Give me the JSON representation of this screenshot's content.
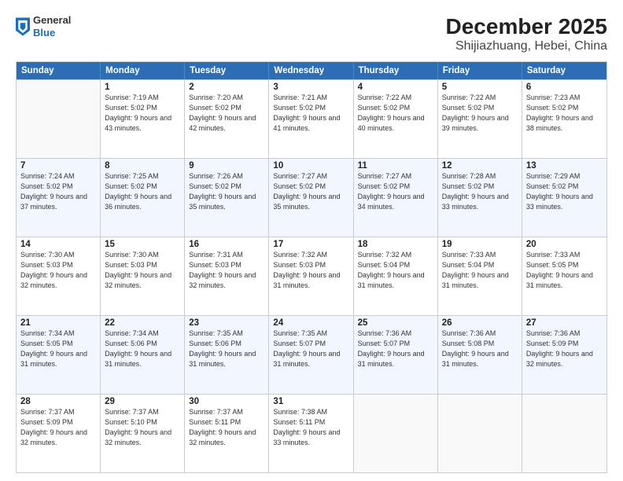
{
  "header": {
    "logo_general": "General",
    "logo_blue": "Blue",
    "title": "December 2025",
    "subtitle": "Shijiazhuang, Hebei, China"
  },
  "calendar": {
    "days_of_week": [
      "Sunday",
      "Monday",
      "Tuesday",
      "Wednesday",
      "Thursday",
      "Friday",
      "Saturday"
    ],
    "weeks": [
      [
        {
          "day": "",
          "sunrise": "",
          "sunset": "",
          "daylight": "",
          "empty": true
        },
        {
          "day": "1",
          "sunrise": "Sunrise: 7:19 AM",
          "sunset": "Sunset: 5:02 PM",
          "daylight": "Daylight: 9 hours and 43 minutes."
        },
        {
          "day": "2",
          "sunrise": "Sunrise: 7:20 AM",
          "sunset": "Sunset: 5:02 PM",
          "daylight": "Daylight: 9 hours and 42 minutes."
        },
        {
          "day": "3",
          "sunrise": "Sunrise: 7:21 AM",
          "sunset": "Sunset: 5:02 PM",
          "daylight": "Daylight: 9 hours and 41 minutes."
        },
        {
          "day": "4",
          "sunrise": "Sunrise: 7:22 AM",
          "sunset": "Sunset: 5:02 PM",
          "daylight": "Daylight: 9 hours and 40 minutes."
        },
        {
          "day": "5",
          "sunrise": "Sunrise: 7:22 AM",
          "sunset": "Sunset: 5:02 PM",
          "daylight": "Daylight: 9 hours and 39 minutes."
        },
        {
          "day": "6",
          "sunrise": "Sunrise: 7:23 AM",
          "sunset": "Sunset: 5:02 PM",
          "daylight": "Daylight: 9 hours and 38 minutes."
        }
      ],
      [
        {
          "day": "7",
          "sunrise": "Sunrise: 7:24 AM",
          "sunset": "Sunset: 5:02 PM",
          "daylight": "Daylight: 9 hours and 37 minutes."
        },
        {
          "day": "8",
          "sunrise": "Sunrise: 7:25 AM",
          "sunset": "Sunset: 5:02 PM",
          "daylight": "Daylight: 9 hours and 36 minutes."
        },
        {
          "day": "9",
          "sunrise": "Sunrise: 7:26 AM",
          "sunset": "Sunset: 5:02 PM",
          "daylight": "Daylight: 9 hours and 35 minutes."
        },
        {
          "day": "10",
          "sunrise": "Sunrise: 7:27 AM",
          "sunset": "Sunset: 5:02 PM",
          "daylight": "Daylight: 9 hours and 35 minutes."
        },
        {
          "day": "11",
          "sunrise": "Sunrise: 7:27 AM",
          "sunset": "Sunset: 5:02 PM",
          "daylight": "Daylight: 9 hours and 34 minutes."
        },
        {
          "day": "12",
          "sunrise": "Sunrise: 7:28 AM",
          "sunset": "Sunset: 5:02 PM",
          "daylight": "Daylight: 9 hours and 33 minutes."
        },
        {
          "day": "13",
          "sunrise": "Sunrise: 7:29 AM",
          "sunset": "Sunset: 5:02 PM",
          "daylight": "Daylight: 9 hours and 33 minutes."
        }
      ],
      [
        {
          "day": "14",
          "sunrise": "Sunrise: 7:30 AM",
          "sunset": "Sunset: 5:03 PM",
          "daylight": "Daylight: 9 hours and 32 minutes."
        },
        {
          "day": "15",
          "sunrise": "Sunrise: 7:30 AM",
          "sunset": "Sunset: 5:03 PM",
          "daylight": "Daylight: 9 hours and 32 minutes."
        },
        {
          "day": "16",
          "sunrise": "Sunrise: 7:31 AM",
          "sunset": "Sunset: 5:03 PM",
          "daylight": "Daylight: 9 hours and 32 minutes."
        },
        {
          "day": "17",
          "sunrise": "Sunrise: 7:32 AM",
          "sunset": "Sunset: 5:03 PM",
          "daylight": "Daylight: 9 hours and 31 minutes."
        },
        {
          "day": "18",
          "sunrise": "Sunrise: 7:32 AM",
          "sunset": "Sunset: 5:04 PM",
          "daylight": "Daylight: 9 hours and 31 minutes."
        },
        {
          "day": "19",
          "sunrise": "Sunrise: 7:33 AM",
          "sunset": "Sunset: 5:04 PM",
          "daylight": "Daylight: 9 hours and 31 minutes."
        },
        {
          "day": "20",
          "sunrise": "Sunrise: 7:33 AM",
          "sunset": "Sunset: 5:05 PM",
          "daylight": "Daylight: 9 hours and 31 minutes."
        }
      ],
      [
        {
          "day": "21",
          "sunrise": "Sunrise: 7:34 AM",
          "sunset": "Sunset: 5:05 PM",
          "daylight": "Daylight: 9 hours and 31 minutes."
        },
        {
          "day": "22",
          "sunrise": "Sunrise: 7:34 AM",
          "sunset": "Sunset: 5:06 PM",
          "daylight": "Daylight: 9 hours and 31 minutes."
        },
        {
          "day": "23",
          "sunrise": "Sunrise: 7:35 AM",
          "sunset": "Sunset: 5:06 PM",
          "daylight": "Daylight: 9 hours and 31 minutes."
        },
        {
          "day": "24",
          "sunrise": "Sunrise: 7:35 AM",
          "sunset": "Sunset: 5:07 PM",
          "daylight": "Daylight: 9 hours and 31 minutes."
        },
        {
          "day": "25",
          "sunrise": "Sunrise: 7:36 AM",
          "sunset": "Sunset: 5:07 PM",
          "daylight": "Daylight: 9 hours and 31 minutes."
        },
        {
          "day": "26",
          "sunrise": "Sunrise: 7:36 AM",
          "sunset": "Sunset: 5:08 PM",
          "daylight": "Daylight: 9 hours and 31 minutes."
        },
        {
          "day": "27",
          "sunrise": "Sunrise: 7:36 AM",
          "sunset": "Sunset: 5:09 PM",
          "daylight": "Daylight: 9 hours and 32 minutes."
        }
      ],
      [
        {
          "day": "28",
          "sunrise": "Sunrise: 7:37 AM",
          "sunset": "Sunset: 5:09 PM",
          "daylight": "Daylight: 9 hours and 32 minutes."
        },
        {
          "day": "29",
          "sunrise": "Sunrise: 7:37 AM",
          "sunset": "Sunset: 5:10 PM",
          "daylight": "Daylight: 9 hours and 32 minutes."
        },
        {
          "day": "30",
          "sunrise": "Sunrise: 7:37 AM",
          "sunset": "Sunset: 5:11 PM",
          "daylight": "Daylight: 9 hours and 32 minutes."
        },
        {
          "day": "31",
          "sunrise": "Sunrise: 7:38 AM",
          "sunset": "Sunset: 5:11 PM",
          "daylight": "Daylight: 9 hours and 33 minutes."
        },
        {
          "day": "",
          "sunrise": "",
          "sunset": "",
          "daylight": "",
          "empty": true
        },
        {
          "day": "",
          "sunrise": "",
          "sunset": "",
          "daylight": "",
          "empty": true
        },
        {
          "day": "",
          "sunrise": "",
          "sunset": "",
          "daylight": "",
          "empty": true
        }
      ]
    ]
  }
}
